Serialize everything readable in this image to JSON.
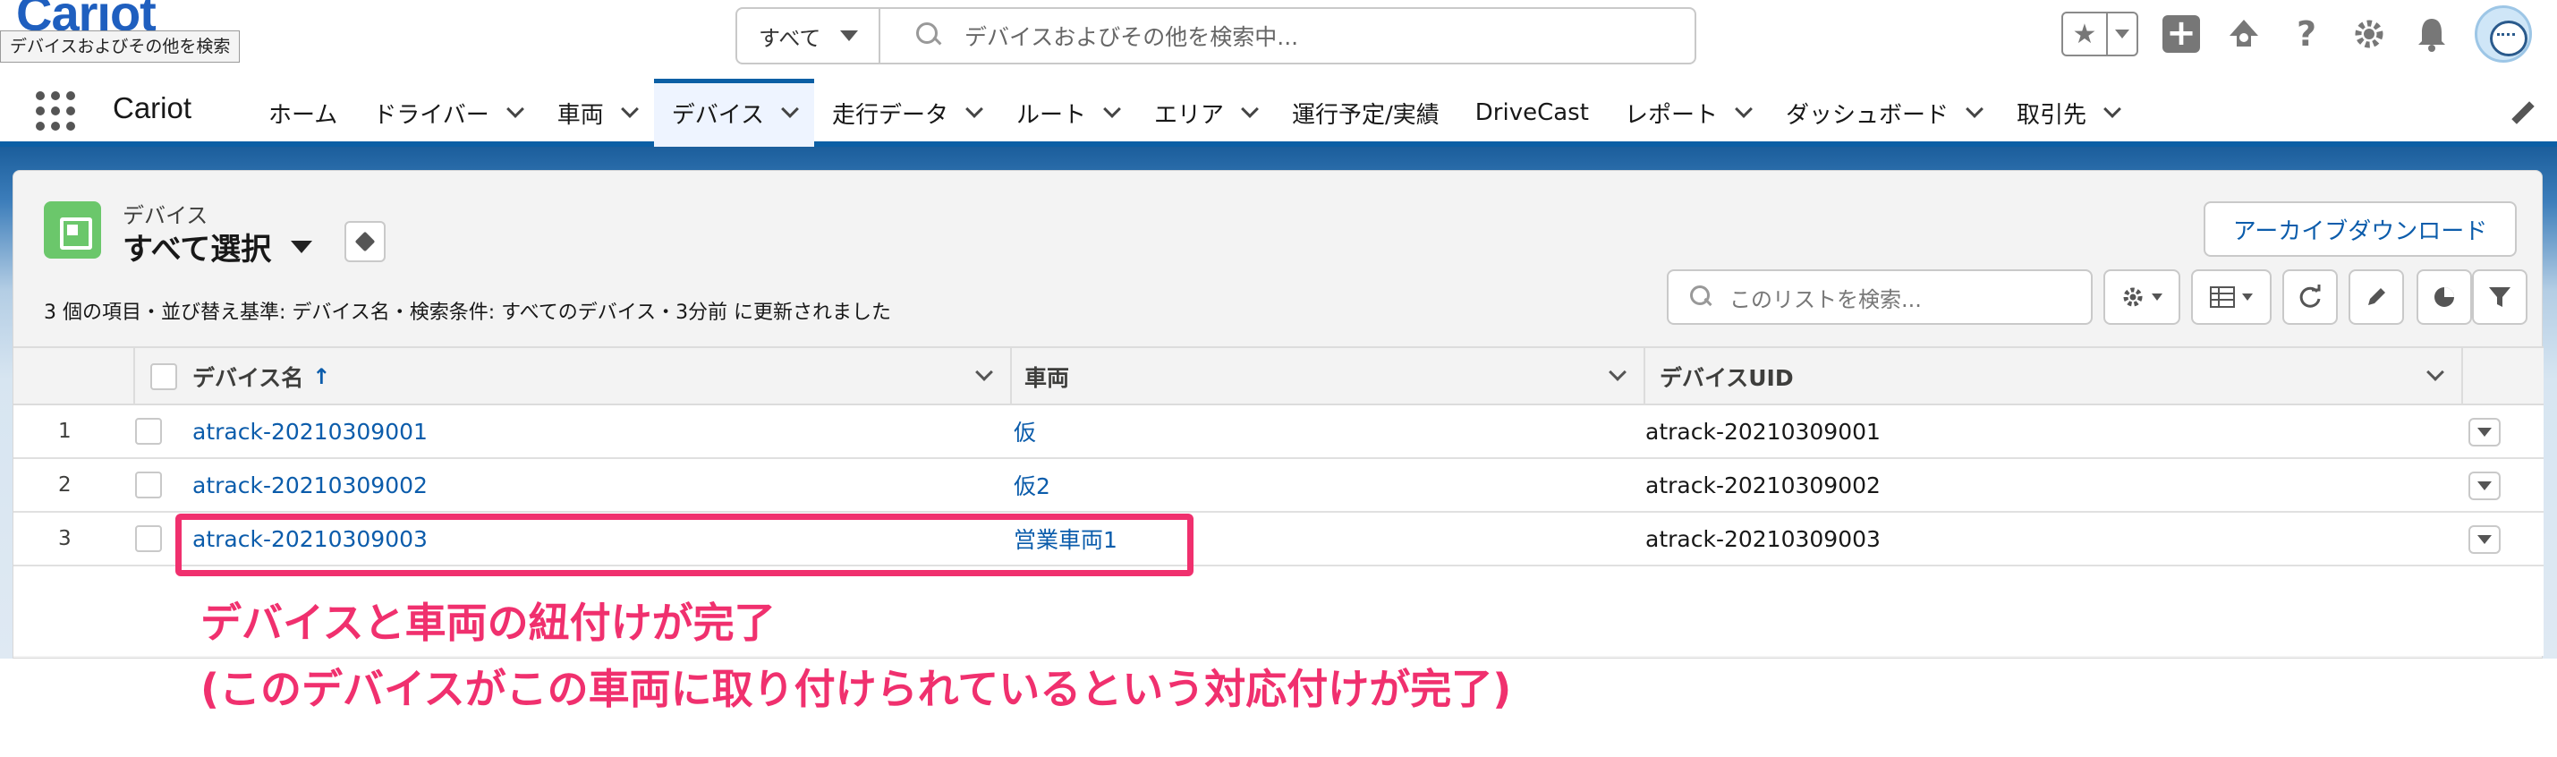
{
  "global_header": {
    "logo_partial": "Cariot",
    "logo_tooltip": "デバイスおよびその他を検索",
    "search": {
      "scope": "すべて",
      "placeholder": "デバイスおよびその他を検索中..."
    },
    "icons": [
      "favorites-star-icon",
      "favorites-dropdown-icon",
      "global-add-icon",
      "setup-trailhead-icon",
      "help-icon",
      "settings-gear-icon",
      "notifications-bell-icon",
      "user-avatar"
    ]
  },
  "nav": {
    "app_name": "Cariot",
    "items": [
      {
        "label": "ホーム",
        "dropdown": false,
        "active": false
      },
      {
        "label": "ドライバー",
        "dropdown": true,
        "active": false
      },
      {
        "label": "車両",
        "dropdown": true,
        "active": false
      },
      {
        "label": "デバイス",
        "dropdown": true,
        "active": true
      },
      {
        "label": "走行データ",
        "dropdown": true,
        "active": false
      },
      {
        "label": "ルート",
        "dropdown": true,
        "active": false
      },
      {
        "label": "エリア",
        "dropdown": true,
        "active": false
      },
      {
        "label": "運行予定/実績",
        "dropdown": false,
        "active": false
      },
      {
        "label": "DriveCast",
        "dropdown": false,
        "active": false
      },
      {
        "label": "レポート",
        "dropdown": true,
        "active": false
      },
      {
        "label": "ダッシュボード",
        "dropdown": true,
        "active": false
      },
      {
        "label": "取引先",
        "dropdown": true,
        "active": false
      }
    ]
  },
  "list_view": {
    "object_label": "デバイス",
    "view_name": "すべて選択",
    "meta": "3 個の項目・並び替え基準: デバイス名・検索条件: すべてのデバイス・3分前 に更新されました",
    "archive_button": "アーカイブダウンロード",
    "search_placeholder": "このリストを検索...",
    "columns": [
      {
        "label": "デバイス名",
        "sorted": "↑"
      },
      {
        "label": "車両"
      },
      {
        "label": "デバイスUID"
      }
    ],
    "rows": [
      {
        "num": "1",
        "name": "atrack-20210309001",
        "vehicle": "仮",
        "uid": "atrack-20210309001"
      },
      {
        "num": "2",
        "name": "atrack-20210309002",
        "vehicle": "仮2",
        "uid": "atrack-20210309002"
      },
      {
        "num": "3",
        "name": "atrack-20210309003",
        "vehicle": "営業車両1",
        "uid": "atrack-20210309003"
      }
    ]
  },
  "annotation": {
    "line1": "デバイスと車両の紐付けが完了",
    "line2": "(このデバイスがこの車両に取り付けられているという対応付けが完了)",
    "color": "#f0306e"
  },
  "colors": {
    "brand_blue": "#0b5fa5",
    "link": "#0b5cab",
    "object_icon_green": "#6bc76b"
  }
}
